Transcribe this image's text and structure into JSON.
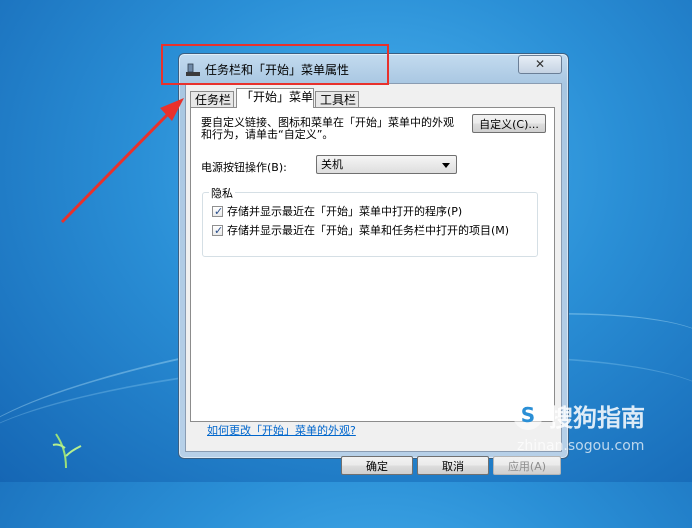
{
  "window": {
    "title": "任务栏和「开始」菜单属性",
    "close_glyph": "✕"
  },
  "tabs": [
    {
      "label": "任务栏",
      "active": false
    },
    {
      "label": "「开始」菜单",
      "active": true
    },
    {
      "label": "工具栏",
      "active": false
    }
  ],
  "start_menu": {
    "description": "要自定义链接、图标和菜单在「开始」菜单中的外观和行为，请单击“自定义”。",
    "customize_button": "自定义(C)...",
    "power_label": "电源按钮操作(B):",
    "power_value": "关机",
    "privacy": {
      "legend": "隐私",
      "options": [
        {
          "label": "存储并显示最近在「开始」菜单中打开的程序(P)",
          "checked": true
        },
        {
          "label": "存储并显示最近在「开始」菜单和任务栏中打开的项目(M)",
          "checked": true
        }
      ]
    },
    "help_link": "如何更改「开始」菜单的外观?"
  },
  "footer": {
    "ok": "确定",
    "cancel": "取消",
    "apply": "应用(A)"
  },
  "watermark": {
    "logo_char": "S",
    "brand": "搜狗指南",
    "url": "zhinan.sogou.com"
  },
  "colors": {
    "annotation_red": "#e8312c",
    "desktop_blue": "#2a8fd6",
    "link_blue": "#0066cc"
  }
}
